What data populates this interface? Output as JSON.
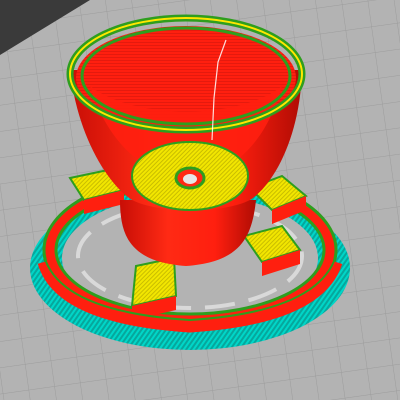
{
  "viewer": {
    "view": "slicer-preview-3d",
    "model": "funnel-on-spoked-base",
    "colors": {
      "bed_background": "#b3b3b3",
      "bed_grid_line": "#9c9c9c",
      "bed_corner_dark": "#3a3a3a",
      "perimeter": "#ff1f0f",
      "external_perimeter": "#ff7a00",
      "infill_solid": "#f2e600",
      "skirt_brim": "#00d6c8",
      "outline_green": "#2e9e1e",
      "hole_interior": "#e6e6e6"
    }
  }
}
